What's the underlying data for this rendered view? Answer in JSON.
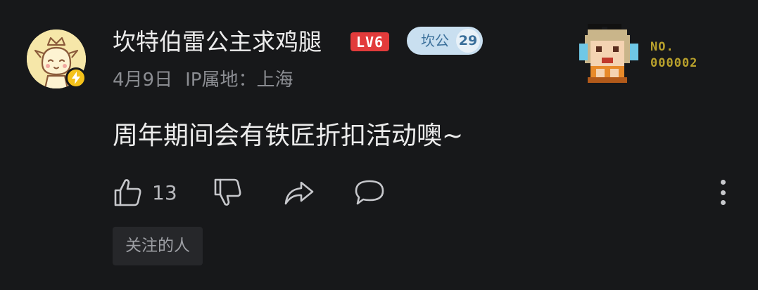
{
  "comment": {
    "user": {
      "name": "坎特伯雷公主求鸡腿",
      "level": "LV6",
      "fan_badge": {
        "name": "坎公",
        "level": "29"
      },
      "avatar_icon": "cartoon-princess-avatar",
      "vip_icon": "lightning-icon"
    },
    "date": "4月9日",
    "ip_location": "IP属地：上海",
    "text": "周年期间会有铁匠折扣活动噢~",
    "decoration": {
      "label_line1": "NO.",
      "label_line2": "000002",
      "icon": "pixel-character-icon"
    },
    "actions": {
      "like_count": "13",
      "like_icon": "thumbs-up-icon",
      "dislike_icon": "thumbs-down-icon",
      "share_icon": "share-arrow-icon",
      "reply_icon": "comment-bubble-icon",
      "more_icon": "more-vertical-icon"
    },
    "tag": "关注的人"
  },
  "colors": {
    "background": "#17181a",
    "level_badge": "#e23b3b",
    "fan_badge": "#c9dff0",
    "vip_badge": "#f4c21b",
    "pixel_label": "#b9a12c"
  }
}
